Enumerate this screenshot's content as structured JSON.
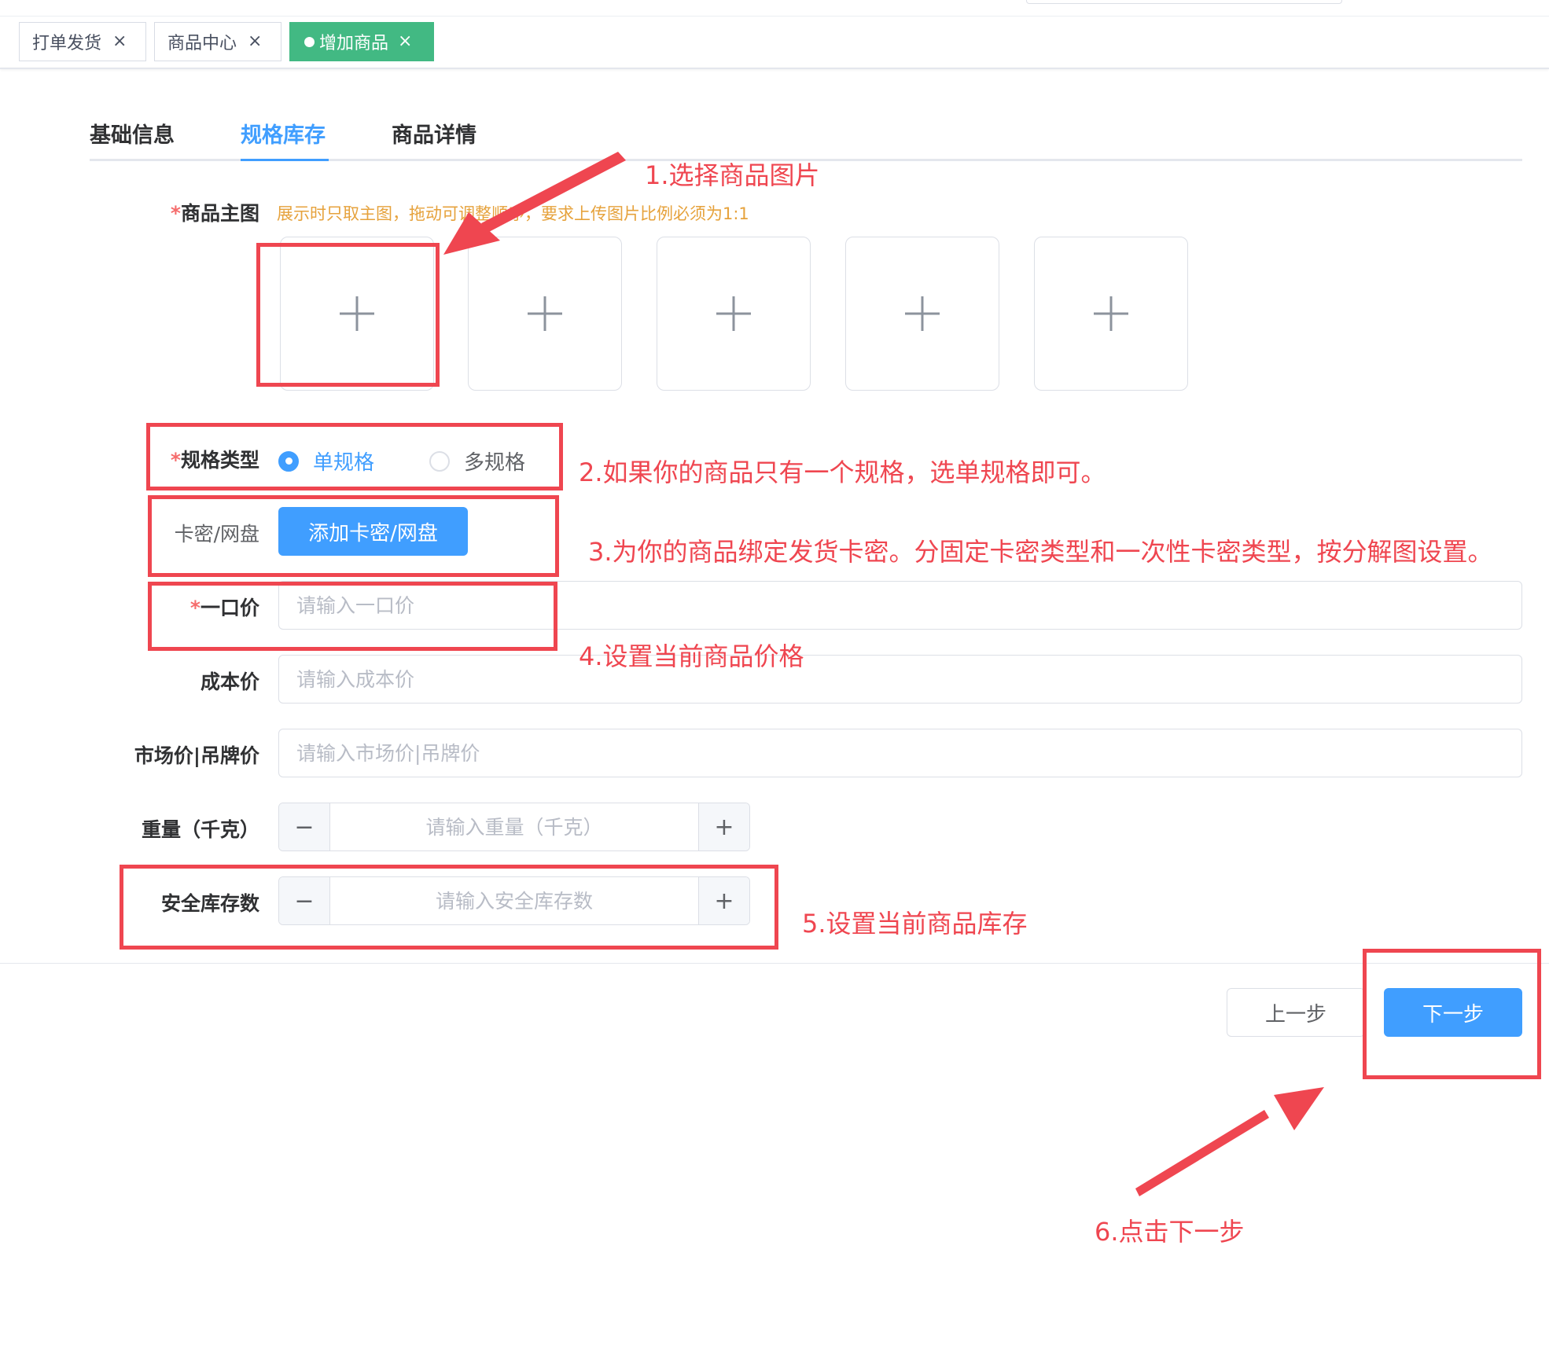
{
  "tags": [
    {
      "label": "打单发货",
      "close": "×"
    },
    {
      "label": "商品中心",
      "close": "×"
    },
    {
      "label": "增加商品",
      "close": "×",
      "active": true
    }
  ],
  "tabs": [
    {
      "label": "基础信息"
    },
    {
      "label": "规格库存",
      "active": true
    },
    {
      "label": "商品详情"
    }
  ],
  "form": {
    "main_image": {
      "required_mark": "*",
      "label": "商品主图",
      "hint": "展示时只取主图，拖动可调整顺序，要求上传图片比例必须为1:1",
      "slot_count": 5
    },
    "spec_type": {
      "required_mark": "*",
      "label": "规格类型",
      "options": [
        {
          "label": "单规格",
          "checked": true
        },
        {
          "label": "多规格",
          "checked": false
        }
      ]
    },
    "card": {
      "label": "卡密/网盘",
      "button": "添加卡密/网盘"
    },
    "price": {
      "required_mark": "*",
      "label": "一口价",
      "placeholder": "请输入一口价"
    },
    "cost": {
      "label": "成本价",
      "placeholder": "请输入成本价"
    },
    "market": {
      "label": "市场价|吊牌价",
      "placeholder": "请输入市场价|吊牌价"
    },
    "weight": {
      "label": "重量（千克）",
      "placeholder": "请输入重量（千克）",
      "minus": "−",
      "plus": "+"
    },
    "stock": {
      "label": "安全库存数",
      "placeholder": "请输入安全库存数",
      "minus": "−",
      "plus": "+"
    }
  },
  "footer": {
    "prev": "上一步",
    "next": "下一步"
  },
  "annotations": [
    "1.选择商品图片",
    "2.如果你的商品只有一个规格，选单规格即可。",
    "3.为你的商品绑定发货卡密。分固定卡密类型和一次性卡密类型，按分解图设置。",
    "4.设置当前商品价格",
    "5.设置当前商品库存",
    "6.点击下一步"
  ],
  "colors": {
    "primary": "#409eff",
    "active_tag": "#42b983",
    "hint": "#e6a23c",
    "annotation": "#ef4650"
  }
}
